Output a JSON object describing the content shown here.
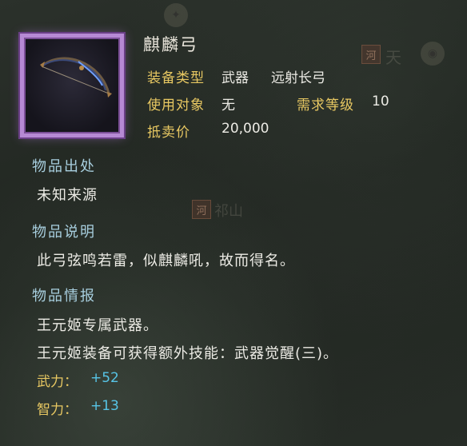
{
  "item": {
    "name": "麒麟弓",
    "rarity_color": "#b689d4",
    "icon": "bow-icon"
  },
  "attributes": {
    "equip_type_label": "装备类型",
    "equip_type_value": "武器",
    "weapon_class": "远射长弓",
    "target_label": "使用对象",
    "target_value": "无",
    "level_req_label": "需求等级",
    "level_req_value": "10",
    "sell_label": "抵卖价",
    "sell_value": "20,000"
  },
  "sections": {
    "origin": {
      "title": "物品出处",
      "text": "未知来源"
    },
    "description": {
      "title": "物品说明",
      "text": "此弓弦鸣若雷，似麒麟吼，故而得名。"
    },
    "intel": {
      "title": "物品情报",
      "lines": [
        "王元姬专属武器。",
        "王元姬装备可获得额外技能：武器觉醒(三)。"
      ]
    }
  },
  "stats": [
    {
      "label": "武力：",
      "value": "+52"
    },
    {
      "label": "智力：",
      "value": "+13"
    }
  ],
  "map_background": {
    "tag_1": "河",
    "place_1": "天",
    "tag_2": "河",
    "place_2": "祁山"
  }
}
